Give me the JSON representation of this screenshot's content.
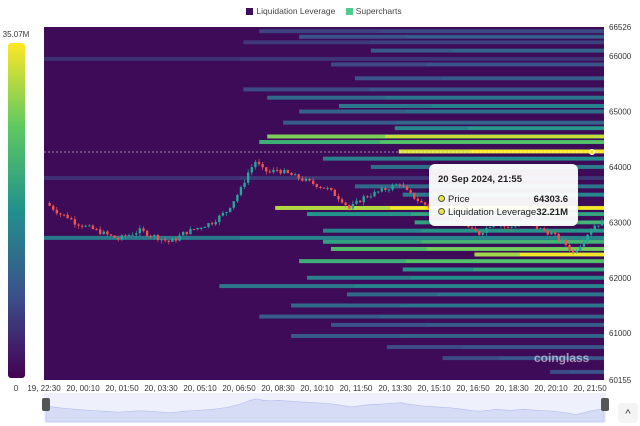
{
  "legend": [
    {
      "label": "Liquidation Leverage",
      "color": "#3b0f5a"
    },
    {
      "label": "Supercharts",
      "color": "#4ecb8d"
    }
  ],
  "colorbar": {
    "max_label": "35.07M",
    "min_label": "0"
  },
  "tooltip": {
    "date": "20 Sep 2024, 21:55",
    "price_label": "Price",
    "price_value": "64303.6",
    "lev_label": "Liquidation Leverage",
    "lev_value": "32.21M"
  },
  "watermark": "coinglass",
  "scroll_top": "^",
  "chart_data": {
    "type": "heatmap",
    "title": "",
    "ylim": [
      60155,
      66526
    ],
    "y_ticks": [
      "66526",
      "66000",
      "65000",
      "64000",
      "63000",
      "62000",
      "61000",
      "60155"
    ],
    "y_tick_values": [
      66526,
      66000,
      65000,
      64000,
      63000,
      62000,
      61000,
      60155
    ],
    "x_ticks": [
      "19, 22:30",
      "20, 00:10",
      "20, 01:50",
      "20, 03:30",
      "20, 05:10",
      "20, 06:50",
      "20, 08:30",
      "20, 10:10",
      "20, 11:50",
      "20, 13:30",
      "20, 15:10",
      "20, 16:50",
      "20, 18:30",
      "20, 20:10",
      "20, 21:50"
    ],
    "x_range_minutes": 1405,
    "value_max_M": 35.07,
    "bands": [
      [
        66450,
        540,
        7
      ],
      [
        66350,
        640,
        9
      ],
      [
        66250,
        500,
        6
      ],
      [
        66100,
        820,
        10
      ],
      [
        65950,
        0,
        5
      ],
      [
        65850,
        720,
        8
      ],
      [
        65600,
        780,
        9
      ],
      [
        65400,
        500,
        8
      ],
      [
        65250,
        560,
        12
      ],
      [
        65100,
        740,
        14
      ],
      [
        65000,
        640,
        11
      ],
      [
        64800,
        600,
        10
      ],
      [
        64700,
        880,
        16
      ],
      [
        64550,
        560,
        28
      ],
      [
        64450,
        540,
        22
      ],
      [
        64280,
        890,
        33
      ],
      [
        64150,
        700,
        15
      ],
      [
        64000,
        820,
        13
      ],
      [
        63800,
        0,
        5
      ],
      [
        63650,
        780,
        12
      ],
      [
        63500,
        900,
        14
      ],
      [
        63260,
        580,
        31
      ],
      [
        63150,
        660,
        18
      ],
      [
        63000,
        930,
        20
      ],
      [
        62850,
        700,
        16
      ],
      [
        62720,
        0,
        14
      ],
      [
        62650,
        700,
        20
      ],
      [
        62520,
        720,
        24
      ],
      [
        62420,
        1080,
        30
      ],
      [
        62300,
        640,
        22
      ],
      [
        62150,
        900,
        18
      ],
      [
        62000,
        660,
        15
      ],
      [
        61850,
        440,
        14
      ],
      [
        61700,
        760,
        12
      ],
      [
        61500,
        620,
        12
      ],
      [
        61300,
        540,
        10
      ],
      [
        61150,
        720,
        9
      ],
      [
        60950,
        620,
        10
      ],
      [
        60750,
        860,
        8
      ],
      [
        60550,
        1000,
        8
      ],
      [
        60300,
        1270,
        8
      ]
    ],
    "price_series": [
      63350,
      63250,
      63150,
      63100,
      63000,
      62950,
      62900,
      62850,
      62800,
      62750,
      62700,
      62750,
      62800,
      62850,
      62800,
      62750,
      62700,
      62650,
      62700,
      62800,
      62850,
      62900,
      62950,
      63000,
      63100,
      63200,
      63400,
      63600,
      63900,
      64100,
      63950,
      63900,
      63950,
      63900,
      63850,
      63800,
      63750,
      63700,
      63650,
      63600,
      63500,
      63400,
      63250,
      63350,
      63450,
      63500,
      63550,
      63600,
      63650,
      63700,
      63550,
      63450,
      63350,
      63300,
      63250,
      63200,
      63150,
      63050,
      62950,
      62850,
      62800,
      62900,
      63000,
      62950,
      62900,
      62950,
      63000,
      62950,
      62900,
      62850,
      62800,
      62700,
      62600,
      62450,
      62600,
      62800,
      62950,
      63000
    ]
  }
}
